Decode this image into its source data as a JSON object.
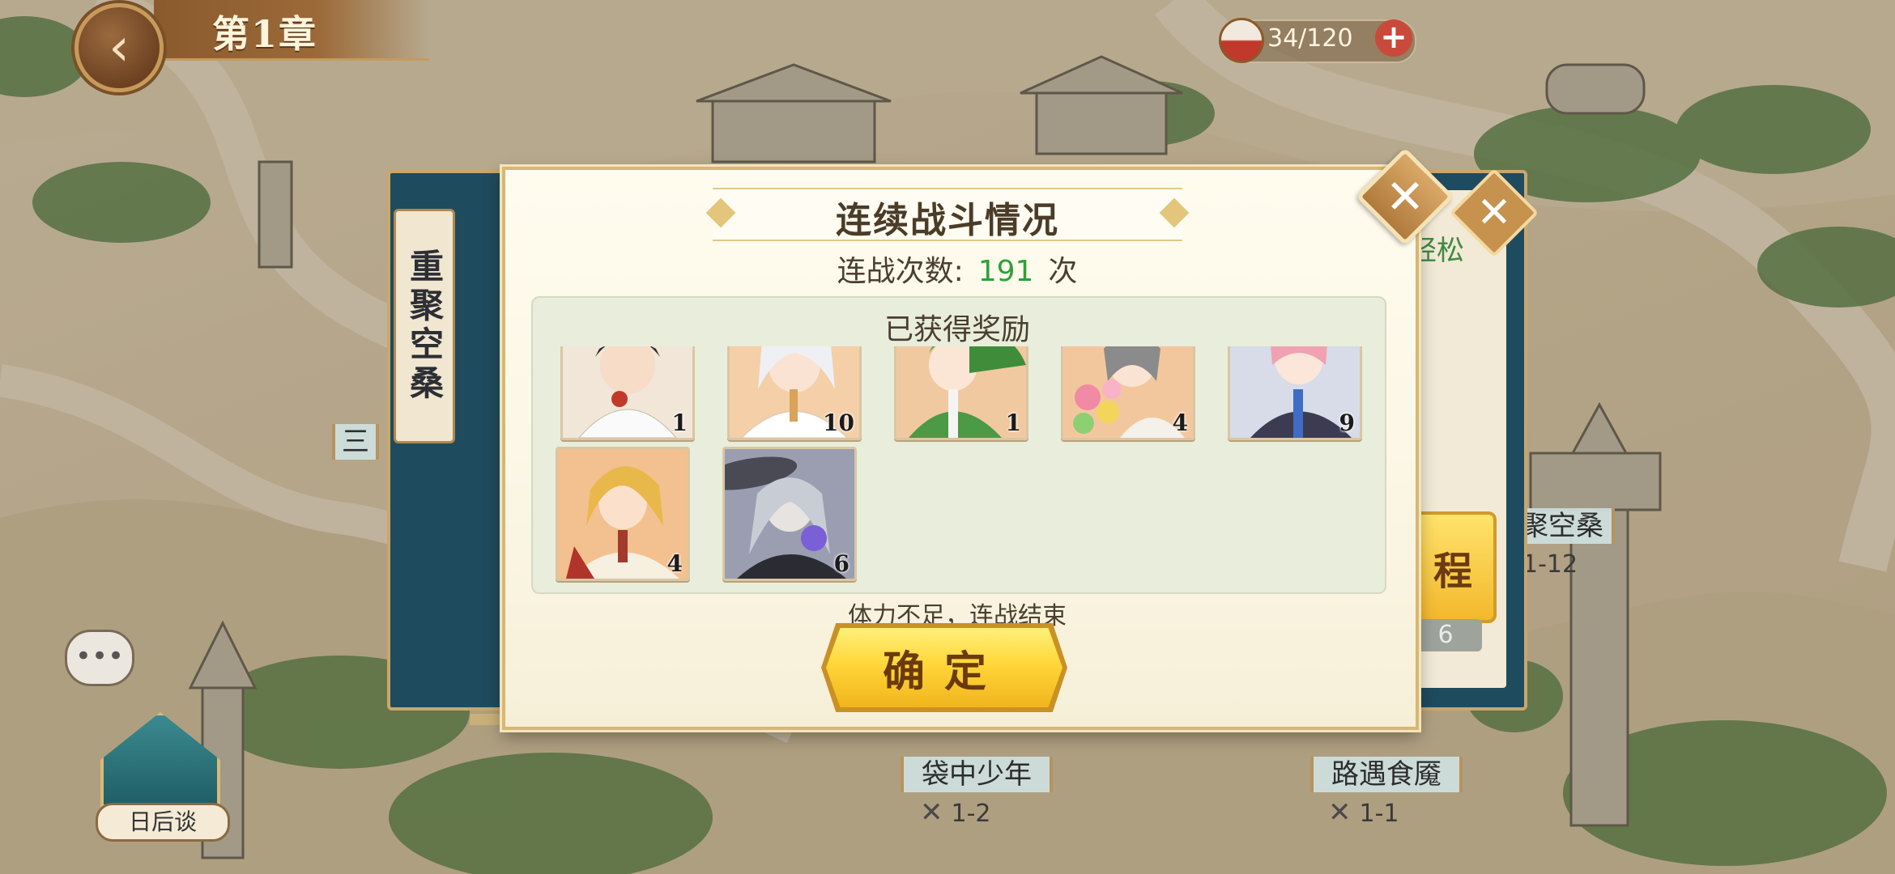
{
  "header": {
    "chapter_title": "第1章",
    "back_icon": "chevron-left-icon"
  },
  "stamina": {
    "value": "34/120",
    "plus": "+"
  },
  "side_tag": "重聚空桑",
  "background_panel": {
    "difficulty": "轻松",
    "button_label": "程",
    "number": "6",
    "close": "✕"
  },
  "map": {
    "stages": [
      {
        "name": "袋中少年",
        "code": "1-2"
      },
      {
        "name": "路遇食魇",
        "code": "1-1"
      },
      {
        "name": "聚空桑",
        "code": "1-12"
      }
    ],
    "partial_label": "三",
    "story_label": "日后谈",
    "chat_icon": "chat-bubble-icon"
  },
  "dialog": {
    "title": "连续战斗情况",
    "battle_count_label": "连战次数:",
    "battle_count": "191",
    "battle_count_unit": "次",
    "rewards_header": "已获得奖励",
    "rewards": [
      {
        "quantity": "1",
        "palette": "#f1e6d8"
      },
      {
        "quantity": "10",
        "palette": "#f4cfa8"
      },
      {
        "quantity": "1",
        "palette": "#f1c9a0"
      },
      {
        "quantity": "4",
        "palette": "#f3c79d"
      },
      {
        "quantity": "9",
        "palette": "#d8dbe8"
      },
      {
        "quantity": "4",
        "palette": "#f3c08f"
      },
      {
        "quantity": "6",
        "palette": "#9a9eb0"
      }
    ],
    "status": "体力不足，连战结束",
    "confirm_label": "确定",
    "close": "✕"
  },
  "colors": {
    "count_green": "#2ea038",
    "confirm_gold": "#ffd63a",
    "panel_teal": "#1f4b5e"
  }
}
